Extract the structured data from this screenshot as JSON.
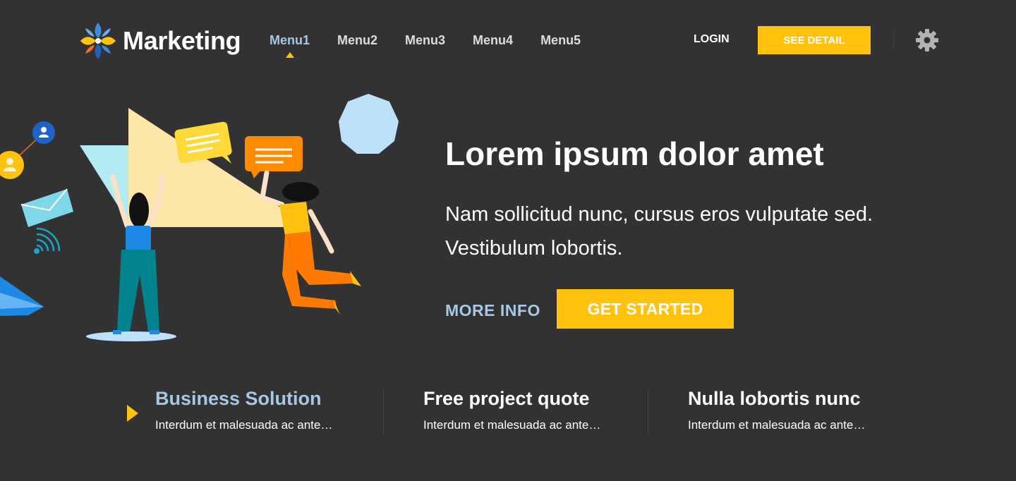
{
  "brand": {
    "name": "Marketing",
    "colors": {
      "accent": "#ffc20e",
      "link": "#a6c7e6",
      "background": "#323232",
      "text": "#ffffff"
    }
  },
  "nav": {
    "items": [
      {
        "label": "Menu1",
        "active": true
      },
      {
        "label": "Menu2",
        "active": false
      },
      {
        "label": "Menu3",
        "active": false
      },
      {
        "label": "Menu4",
        "active": false
      },
      {
        "label": "Menu5",
        "active": false
      }
    ]
  },
  "header": {
    "login_label": "LOGIN",
    "see_detail_label": "SEE DETAIL",
    "settings_icon": "gear-icon"
  },
  "hero": {
    "title": "Lorem ipsum dolor amet",
    "text": "Nam sollicitud nunc, cursus eros vulputate sed. Vestibulum lobortis.",
    "more_info_label": "MORE INFO",
    "get_started_label": "GET STARTED"
  },
  "features": [
    {
      "title": "Business Solution",
      "desc": "Interdum et malesuada ac ante…",
      "active": true
    },
    {
      "title": "Free project quote",
      "desc": "Interdum et malesuada ac ante…",
      "active": false
    },
    {
      "title": "Nulla lobortis nunc",
      "desc": "Interdum et malesuada ac ante…",
      "active": false
    }
  ]
}
